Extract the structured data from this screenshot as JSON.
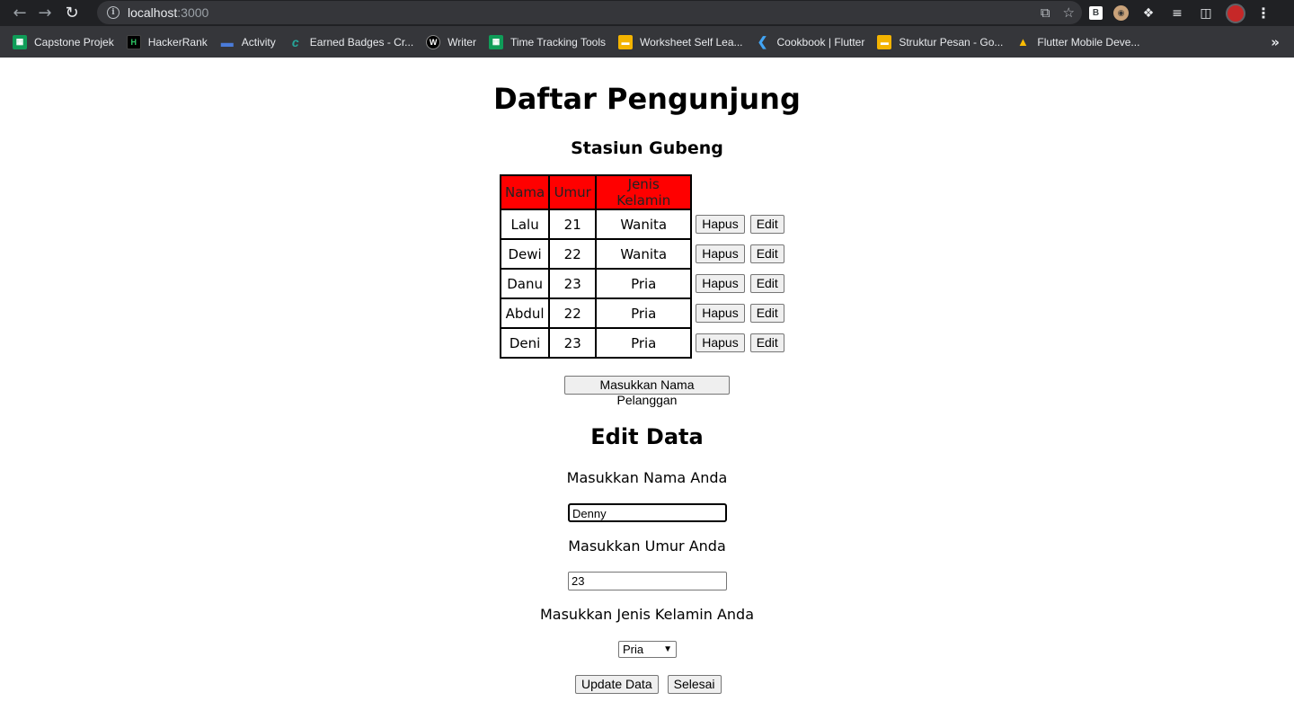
{
  "browser": {
    "url_host": "localhost",
    "url_port": ":3000",
    "bookmarks": [
      {
        "label": "Capstone Projek",
        "icon": "sheets-icon"
      },
      {
        "label": "HackerRank",
        "icon": "hackerrank-icon"
      },
      {
        "label": "Activity",
        "icon": "activity-icon"
      },
      {
        "label": "Earned Badges - Cr...",
        "icon": "credly-icon"
      },
      {
        "label": "Writer",
        "icon": "writer-icon"
      },
      {
        "label": "Time Tracking Tools",
        "icon": "sheets-icon"
      },
      {
        "label": "Worksheet Self Lea...",
        "icon": "slides-icon"
      },
      {
        "label": "Cookbook | Flutter",
        "icon": "flutter-icon"
      },
      {
        "label": "Struktur Pesan - Go...",
        "icon": "slides-icon"
      },
      {
        "label": "Flutter Mobile Deve...",
        "icon": "drive-icon"
      }
    ]
  },
  "page": {
    "title": "Daftar Pengunjung",
    "subtitle": "Stasiun Gubeng",
    "table": {
      "headers": [
        "Nama",
        "Umur",
        "Jenis Kelamin"
      ],
      "rows": [
        {
          "nama": "Lalu",
          "umur": "21",
          "jk": "Wanita"
        },
        {
          "nama": "Dewi",
          "umur": "22",
          "jk": "Wanita"
        },
        {
          "nama": "Danu",
          "umur": "23",
          "jk": "Pria"
        },
        {
          "nama": "Abdul",
          "umur": "22",
          "jk": "Pria"
        },
        {
          "nama": "Deni",
          "umur": "23",
          "jk": "Pria"
        }
      ],
      "delete_label": "Hapus",
      "edit_label": "Edit"
    },
    "add_button": "Masukkan Nama Pelanggan",
    "edit": {
      "title": "Edit Data",
      "name_label": "Masukkan Nama Anda",
      "name_value": "Denny",
      "age_label": "Masukkan Umur Anda",
      "age_value": "23",
      "gender_label": "Masukkan Jenis Kelamin Anda",
      "gender_value": "Pria",
      "update_button": "Update Data",
      "done_button": "Selesai"
    }
  }
}
